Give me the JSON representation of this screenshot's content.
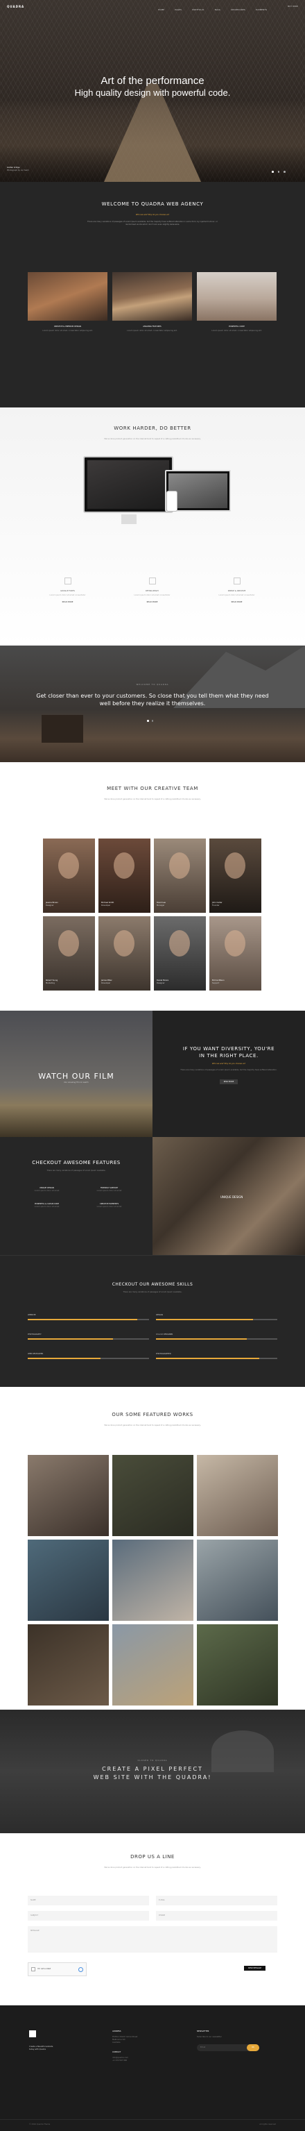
{
  "nav": {
    "logo": "QUADRA",
    "items": [
      "HOME",
      "PAGES",
      "PORTFOLIO",
      "BLOG",
      "SHORTCODES",
      "ELEMENTS"
    ],
    "cta": "BUY NOW"
  },
  "hero": {
    "line1": "Art of the performance",
    "line2": "High quality design with powerful code.",
    "caption_title": "Golden bridge",
    "caption_sub": "Photograph by our team"
  },
  "welcome": {
    "title": "WELCOME TO QUADRA WEB AGENCY",
    "sub": "Who we are? Why do you choose us?",
    "text": "There are many variations of passages of Lorem Ipsum available, but the majority have suffered alteration in some form, by injected humour, or randomised words which don't look even slightly believable.",
    "cards": [
      {
        "title": "CREATIVE & PREMIUM DESIGN",
        "text": "Lorem ipsum dolor sit amet, consectetur adipiscing elit."
      },
      {
        "title": "AMAZING FEATURES",
        "text": "Lorem ipsum dolor sit amet, consectetur adipiscing elit."
      },
      {
        "title": "POWERFUL CODE",
        "text": "Lorem ipsum dolor sit amet, consectetur adipiscing elit."
      }
    ]
  },
  "work": {
    "title": "WORK HARDER, DO BETTER",
    "text": "We've done product generation on the internet tend to repeat of a cutting predefined chunks as necessary.",
    "features": [
      {
        "title": "GOOGLE FONTS",
        "text": "Lorem ipsum dolor sit amet consectetur",
        "link": "READ MORE"
      },
      {
        "title": "RETINA READY",
        "text": "Lorem ipsum dolor sit amet consectetur",
        "link": "READ MORE"
      },
      {
        "title": "SIMPLE & CREATIVE",
        "text": "Lorem ipsum dolor sit amet consectetur",
        "link": "READ MORE"
      }
    ]
  },
  "quote": {
    "label": "WELCOME TO QUADRA",
    "text": "Get closer than ever to your customers. So close that you tell them what they need well before they realize it themselves."
  },
  "team": {
    "title": "MEET WITH OUR CREATIVE TEAM",
    "text": "We've done product generation on the internet tend to repeat of a cutting predefined chunks as necessary.",
    "members": [
      {
        "name": "Jessica Brown",
        "role": "Designer"
      },
      {
        "name": "Michael Smith",
        "role": "Developer"
      },
      {
        "name": "David Lee",
        "role": "Manager"
      },
      {
        "name": "John Carter",
        "role": "Founder"
      },
      {
        "name": "Robert Young",
        "role": "Marketing"
      },
      {
        "name": "James Miller",
        "role": "Developer"
      },
      {
        "name": "Daniel Moore",
        "role": "Designer"
      },
      {
        "name": "Emma Wilson",
        "role": "Support"
      }
    ]
  },
  "film": {
    "title": "WATCH OUR FILM",
    "sub": "Our Amazing Film to watch",
    "right_title1": "IF YOU WANT DIVERSITY, YOU'RE",
    "right_title2": "IN THE RIGHT PLACE.",
    "right_sub": "Who we are? Why do you choose us?",
    "right_text": "There are many variations of passages of Lorem Ipsum available, but the majority have suffered alteration.",
    "button": "READ MORE"
  },
  "features": {
    "title": "CHECKOUT AWESOME FEATURES",
    "text": "There are many variations of passages of Lorem Ipsum available.",
    "items": [
      {
        "title": "UNIQUE DESIGN",
        "text": "Lorem ipsum dolor sit amet"
      },
      {
        "title": "FRIENDLY SUPPORT",
        "text": "Lorem ipsum dolor sit amet"
      },
      {
        "title": "POWERFUL & CLEAN CODE",
        "text": "Lorem ipsum dolor sit amet"
      },
      {
        "title": "CREATIVE ELEMENTS",
        "text": "Lorem ipsum dolor sit amet"
      }
    ],
    "photo_label": "UNIQUE DESIGN"
  },
  "skills": {
    "title": "CHECKOUT OUR AWESOME SKILLS",
    "text": "There are many variations of passages of Lorem Ipsum available.",
    "items": [
      {
        "label": "WEBSITE",
        "value": 0.9
      },
      {
        "label": "DESIGN",
        "value": 0.8
      },
      {
        "label": "PHOTOGRAPHY",
        "value": 0.7
      },
      {
        "label": "UI & UX DESIGNER",
        "value": 0.75
      },
      {
        "label": "WEB DEVELOPER",
        "value": 0.6
      },
      {
        "label": "PHOTOGRAPHER",
        "value": 0.85
      }
    ]
  },
  "works": {
    "title": "OUR SOME FEATURED WORKS",
    "text": "We've done product generation on the internet tend to repeat of a cutting predefined chunks as necessary."
  },
  "banner": {
    "label": "CLOSER TO QUADRA",
    "line1": "CREATE A PIXEL PERFECT",
    "line2": "WEB SITE WITH THE QUADRA!"
  },
  "contact": {
    "title": "DROP US A LINE",
    "text": "We've done product generation on the internet tend to repeat of a cutting predefined chunks as necessary.",
    "name_ph": "NAME",
    "email_ph": "E-MAIL",
    "subject_ph": "SUBJECT",
    "phone_ph": "PHONE",
    "message_ph": "MESSAGE",
    "captcha": "I'm not a robot",
    "send": "SEND MESSAGE"
  },
  "footer": {
    "tagline1": "Create a Beautiful website",
    "tagline2": "today with Quadra",
    "col2_title": "ADDRESS",
    "col2_lines": [
      "PO Box 16122 Collins Street",
      "Melbourne VIC",
      "Australia"
    ],
    "col2b_title": "CONTACT",
    "col2b_lines": [
      "info@quadra.com",
      "+1 234 567 890"
    ],
    "col3_title": "NEWSLETTER",
    "col3_text": "Subscribe to our newsletter",
    "col3_ph": "Email",
    "col3_btn": "OK",
    "copyright": "© 2024 Quadra Theme",
    "credit": "All rights reserved"
  }
}
